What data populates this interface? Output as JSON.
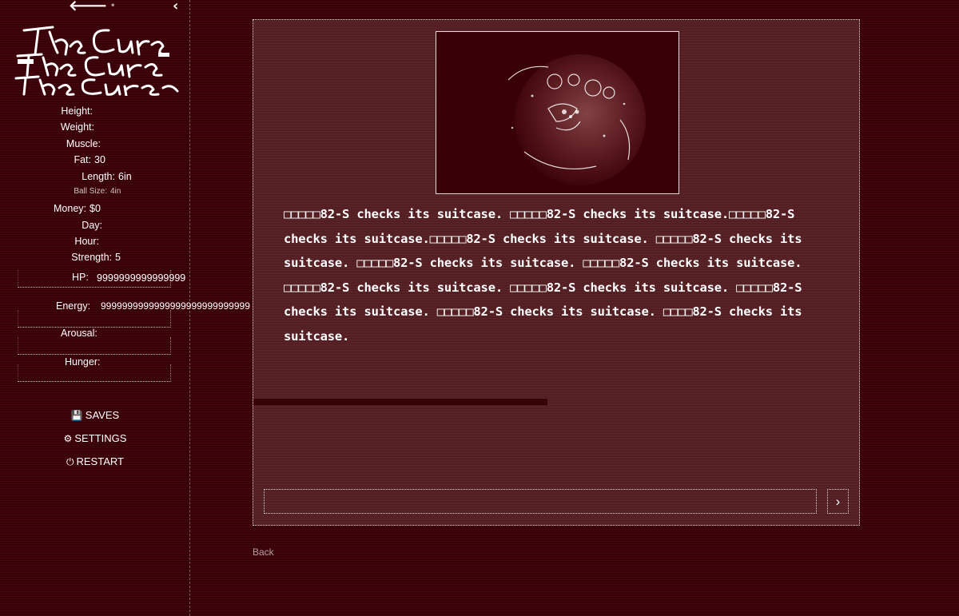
{
  "sidebar": {
    "icons": {
      "back": "arrow-left-icon",
      "collapse": "chevron-left-icon"
    },
    "logo_text": "The Curse",
    "stats": [
      {
        "label": "Height:",
        "value": ""
      },
      {
        "label": "Weight:",
        "value": ""
      },
      {
        "label": "Muscle:",
        "value": ""
      },
      {
        "label": "Fat:",
        "value": "30"
      },
      {
        "label": "Length:",
        "value": "6in"
      },
      {
        "label": "Ball Size:",
        "value": "4in"
      },
      {
        "label": "Money:",
        "value": "$0"
      },
      {
        "label": "Day:",
        "value": ""
      },
      {
        "label": "Hour:",
        "value": ""
      },
      {
        "label": "Strength:",
        "value": "5"
      }
    ],
    "bars": {
      "hp": {
        "label": "HP:",
        "value": "9999999999999999"
      },
      "energy": {
        "label": "Energy:",
        "value": "9999999999999999999999999999"
      },
      "arousal": {
        "label": "Arousal:",
        "value": ""
      },
      "hunger": {
        "label": "Hunger:",
        "value": ""
      }
    },
    "menu": {
      "saves": "SAVES",
      "settings": "SETTINGS",
      "restart": "RESTART"
    }
  },
  "main": {
    "story_text": "□□□□□82-S checks its suitcase. □□□□□82-S checks its suitcase.□□□□□82-S checks its suitcase.□□□□□82-S checks its suitcase. □□□□□82-S checks its suitcase. □□□□□82-S checks its suitcase. □□□□□82-S checks its suitcase. □□□□□82-S checks its suitcase. □□□□□82-S checks its suitcase. □□□□□82-S checks its suitcase. □□□□□82-S checks its suitcase. □□□□82-S checks its suitcase.",
    "input": {
      "value": "",
      "placeholder": ""
    },
    "submit_icon": "chevron-right-icon",
    "footer_link": "Back"
  },
  "colors": {
    "background": "#3a0008",
    "text": "#ffffff"
  }
}
